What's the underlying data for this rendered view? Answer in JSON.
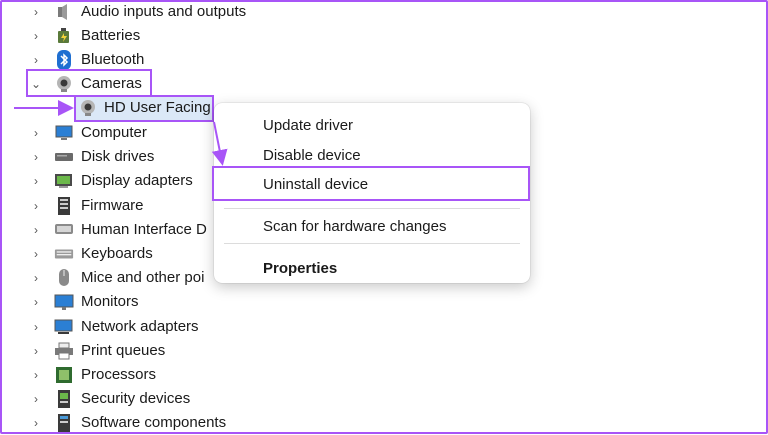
{
  "tree": {
    "items": [
      {
        "label": "Audio inputs and outputs",
        "icon": "speaker-icon",
        "expanded": false
      },
      {
        "label": "Batteries",
        "icon": "battery-icon",
        "expanded": false
      },
      {
        "label": "Bluetooth",
        "icon": "bluetooth-icon",
        "expanded": false
      },
      {
        "label": "Cameras",
        "icon": "camera-icon",
        "expanded": true
      },
      {
        "label": "Computer",
        "icon": "computer-icon",
        "expanded": false
      },
      {
        "label": "Disk drives",
        "icon": "disk-drive-icon",
        "expanded": false
      },
      {
        "label": "Display adapters",
        "icon": "display-adapter-icon",
        "expanded": false
      },
      {
        "label": "Firmware",
        "icon": "firmware-icon",
        "expanded": false
      },
      {
        "label": "Human Interface D",
        "icon": "hid-icon",
        "expanded": false
      },
      {
        "label": "Keyboards",
        "icon": "keyboard-icon",
        "expanded": false
      },
      {
        "label": "Mice and other poi",
        "icon": "mouse-icon",
        "expanded": false
      },
      {
        "label": "Monitors",
        "icon": "monitor-icon",
        "expanded": false
      },
      {
        "label": "Network adapters",
        "icon": "network-adapter-icon",
        "expanded": false
      },
      {
        "label": "Print queues",
        "icon": "printer-icon",
        "expanded": false
      },
      {
        "label": "Processors",
        "icon": "processor-icon",
        "expanded": false
      },
      {
        "label": "Security devices",
        "icon": "security-device-icon",
        "expanded": false
      },
      {
        "label": "Software components",
        "icon": "software-component-icon",
        "expanded": false
      }
    ],
    "child_device": {
      "label": "HD User Facing",
      "icon": "webcam-icon"
    }
  },
  "context_menu": {
    "items": [
      {
        "label": "Update driver"
      },
      {
        "label": "Disable device"
      },
      {
        "label": "Uninstall device",
        "highlighted": true
      },
      {
        "label": "Scan for hardware changes"
      },
      {
        "label": "Properties",
        "bold": true
      }
    ]
  },
  "colors": {
    "annotation": "#a855f7",
    "selection": "#dbe8f7"
  }
}
